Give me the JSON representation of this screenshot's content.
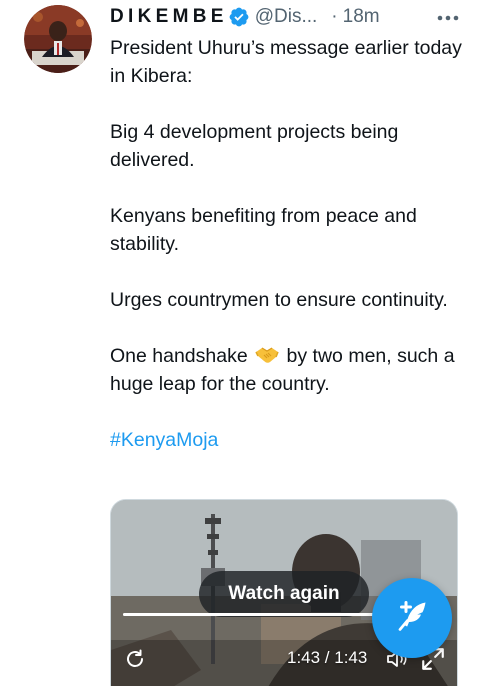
{
  "tweet": {
    "author": {
      "display_name": "DIKEMBE",
      "handle": "@Dis...",
      "verified": true,
      "avatar_icon": "author-avatar"
    },
    "separator": "·",
    "timestamp": "18m",
    "more_icon": "more-horizontal-icon",
    "paragraphs": [
      "President Uhuru’s message earlier today in Kibera:",
      "Big 4 development projects being delivered.",
      "Kenyans benefiting from peace and stability.",
      "Urges countrymen to ensure continuity."
    ],
    "handshake_line": {
      "before": "One handshake",
      "emoji": "handshake-emoji",
      "after": "by two men, such a huge leap for the country."
    },
    "hashtag": "#KenyaMoja"
  },
  "video": {
    "watch_again_label": "Watch again",
    "time_readout": "1:43 / 1:43",
    "progress_fraction": 1.0,
    "replay_icon": "replay-icon",
    "volume_icon": "volume-muted-icon",
    "fullscreen_icon": "fullscreen-icon"
  },
  "compose_fab": {
    "icon": "compose-tweet-icon"
  },
  "colors": {
    "accent": "#1d9bf0",
    "text": "#0f1419",
    "secondary_text": "#536471"
  }
}
